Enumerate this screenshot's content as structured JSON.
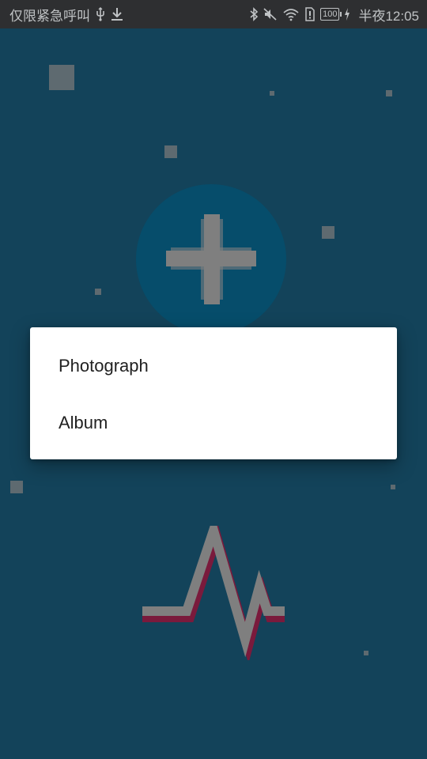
{
  "status_bar": {
    "carrier_text": "仅限紧急呼叫",
    "usb_icon": "usb-icon",
    "download_icon": "download-icon",
    "bluetooth_icon": "bluetooth-icon",
    "mute_icon": "mute-icon",
    "wifi_icon": "wifi-icon",
    "alert_icon": "sim-alert-icon",
    "battery_level": "100",
    "charging_icon": "charging-icon",
    "time": "半夜12:05"
  },
  "main": {
    "add_button_icon": "plus-icon",
    "heartbeat_icon": "heartbeat-icon"
  },
  "dialog": {
    "items": [
      {
        "label": "Photograph"
      },
      {
        "label": "Album"
      }
    ]
  },
  "colors": {
    "background": "#13435a",
    "status_bar": "#2e2f31",
    "circle": "#064d6b",
    "icon_gray": "#7f7f7f",
    "heartbeat_shadow": "#7a1a3c",
    "dialog_bg": "#ffffff",
    "dialog_text": "#212121"
  }
}
